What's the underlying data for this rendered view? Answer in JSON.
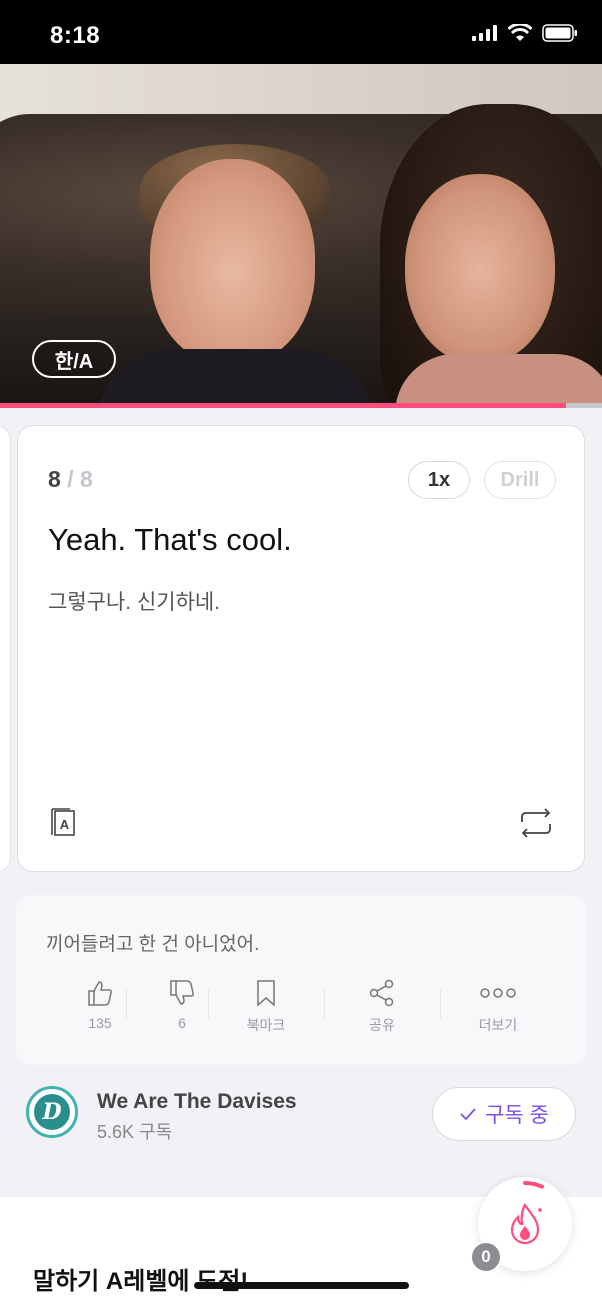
{
  "status_bar": {
    "time": "8:18"
  },
  "video": {
    "subtitle_toggle": "한/A",
    "progress_fraction": 0.94
  },
  "card": {
    "current": "8",
    "separator": "/",
    "total": "8",
    "speed_label": "1x",
    "drill_label": "Drill",
    "sentence_en": "Yeah. That's cool.",
    "sentence_ko": "그렇구나. 신기하네.",
    "dict_icon_letter": "A"
  },
  "comments": {
    "text": "끼어들려고 한 건 아니었어.",
    "actions": [
      {
        "icon": "thumbs-up-icon",
        "label": "135"
      },
      {
        "icon": "thumbs-down-icon",
        "label": "6"
      },
      {
        "icon": "bookmark-icon",
        "label": "북마크"
      },
      {
        "icon": "share-icon",
        "label": "공유"
      },
      {
        "icon": "more-icon",
        "label": "더보기"
      }
    ]
  },
  "channel": {
    "logo_letter": "D",
    "name": "We Are The Davises",
    "subscribers": "5.6K 구독",
    "subscribe_label": "구독 중"
  },
  "challenge": {
    "title": "말하기 A레벨에 도전!"
  },
  "streak": {
    "count": "0"
  },
  "colors": {
    "accent": "#ff4d7d",
    "subscribe": "#7a4fe6"
  }
}
